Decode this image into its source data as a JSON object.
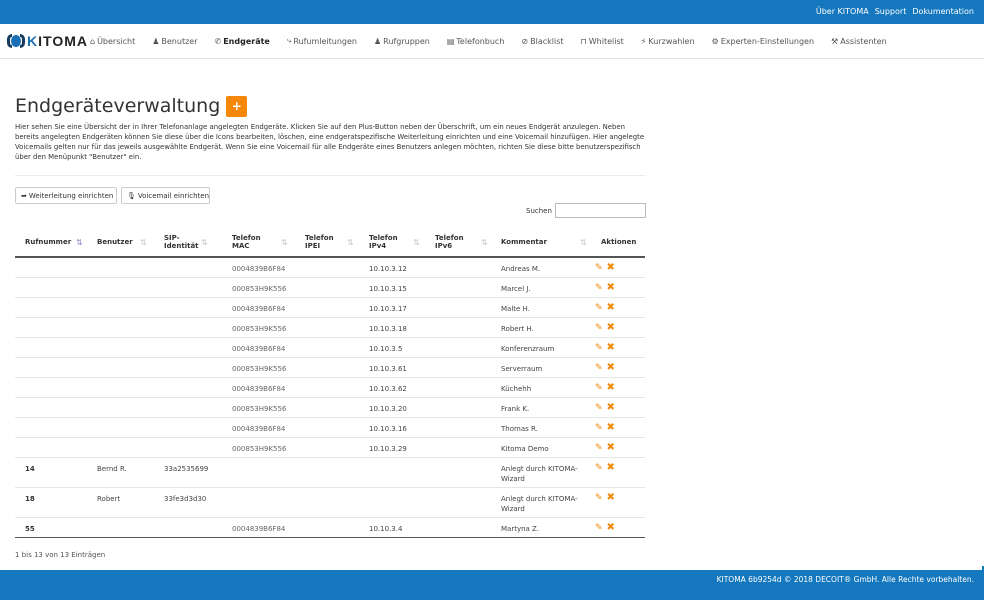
{
  "topbar": {
    "links": [
      "Über KITOMA",
      "Support",
      "Dokumentation"
    ]
  },
  "logo": {
    "text_k": "K",
    "text_rest": "ITOMA"
  },
  "nav": {
    "items": [
      {
        "label": "Übersicht",
        "icon": "home-icon",
        "glyph": "⌂"
      },
      {
        "label": "Benutzer",
        "icon": "user-icon",
        "glyph": "♟"
      },
      {
        "label": "Endgeräte",
        "icon": "phone-icon",
        "glyph": "✆"
      },
      {
        "label": "Rufumleitungen",
        "icon": "forward-icon",
        "glyph": "⤷"
      },
      {
        "label": "Rufgruppen",
        "icon": "users-icon",
        "glyph": "♟"
      },
      {
        "label": "Telefonbuch",
        "icon": "book-icon",
        "glyph": "▤"
      },
      {
        "label": "Blacklist",
        "icon": "ban-icon",
        "glyph": "⊘"
      },
      {
        "label": "Whitelist",
        "icon": "unlock-icon",
        "glyph": "⊓"
      },
      {
        "label": "Kurzwahlen",
        "icon": "bolt-icon",
        "glyph": "⚡"
      },
      {
        "label": "Experten-Einstellungen",
        "icon": "gears-icon",
        "glyph": "⚙"
      },
      {
        "label": "Assistenten",
        "icon": "wand-icon",
        "glyph": "⚒"
      }
    ],
    "active": "Endgeräte"
  },
  "page": {
    "title": "Endgeräteverwaltung",
    "plus_label": "+",
    "description": "Hier sehen Sie eine Übersicht der in Ihrer Telefonanlage angelegten Endgeräte. Klicken Sie auf den Plus-Button neben der Überschrift, um ein neues Endgerät anzulegen. Neben bereits angelegten Endgeräten können Sie diese über die Icons bearbeiten, löschen, eine endgeratspezifische Weiterleitung einrichten und eine Voicemail hinzufügen. Hier angelegte Voicemails gelten nur für das jeweils ausgewählte Endgerät. Wenn Sie eine Voicemail für alle Endgeräte eines Benutzers anlegen möchten, richten Sie diese bitte benutzerspezifisch über den Menüpunkt \"Benutzer\" ein."
  },
  "toolbar": {
    "forward_label": "Weiterleitung einrichten",
    "voicemail_label": "Voicemail einrichten"
  },
  "search": {
    "label": "Suchen",
    "value": "",
    "placeholder": ""
  },
  "table": {
    "headers": [
      {
        "line1": "Rufnummer",
        "line2": ""
      },
      {
        "line1": "Benutzer",
        "line2": ""
      },
      {
        "line1": "SIP-",
        "line2": "Identität"
      },
      {
        "line1": "Telefon",
        "line2": "MAC"
      },
      {
        "line1": "Telefon",
        "line2": "IPEI"
      },
      {
        "line1": "Telefon",
        "line2": "IPv4"
      },
      {
        "line1": "Telefon",
        "line2": "IPv6"
      },
      {
        "line1": "Kommentar",
        "line2": ""
      },
      {
        "line1": "Aktionen",
        "line2": ""
      }
    ],
    "rows": [
      {
        "rufnummer": "",
        "benutzer": "",
        "sip": "",
        "mac": "0004839B6F84",
        "ipei": "",
        "ipv4": "10.10.3.12",
        "ipv6": "",
        "kommentar": "Andreas M.",
        "tall": false
      },
      {
        "rufnummer": "",
        "benutzer": "",
        "sip": "",
        "mac": "000853H9K556",
        "ipei": "",
        "ipv4": "10.10.3.15",
        "ipv6": "",
        "kommentar": "Marcel J.",
        "tall": false
      },
      {
        "rufnummer": "",
        "benutzer": "",
        "sip": "",
        "mac": "0004839B6F84",
        "ipei": "",
        "ipv4": "10.10.3.17",
        "ipv6": "",
        "kommentar": "Malte H.",
        "tall": false
      },
      {
        "rufnummer": "",
        "benutzer": "",
        "sip": "",
        "mac": "000853H9K556",
        "ipei": "",
        "ipv4": "10.10.3.18",
        "ipv6": "",
        "kommentar": "Robert H.",
        "tall": false
      },
      {
        "rufnummer": "",
        "benutzer": "",
        "sip": "",
        "mac": "0004839B6F84",
        "ipei": "",
        "ipv4": "10.10.3.5",
        "ipv6": "",
        "kommentar": "Konferenzraum",
        "tall": false
      },
      {
        "rufnummer": "",
        "benutzer": "",
        "sip": "",
        "mac": "000853H9K556",
        "ipei": "",
        "ipv4": "10.10.3.61",
        "ipv6": "",
        "kommentar": "Serverraum",
        "tall": false
      },
      {
        "rufnummer": "",
        "benutzer": "",
        "sip": "",
        "mac": "0004839B6F84",
        "ipei": "",
        "ipv4": "10.10.3.62",
        "ipv6": "",
        "kommentar": "Küchehh",
        "tall": false
      },
      {
        "rufnummer": "",
        "benutzer": "",
        "sip": "",
        "mac": "000853H9K556",
        "ipei": "",
        "ipv4": "10.10.3.20",
        "ipv6": "",
        "kommentar": "Frank K.",
        "tall": false
      },
      {
        "rufnummer": "",
        "benutzer": "",
        "sip": "",
        "mac": "0004839B6F84",
        "ipei": "",
        "ipv4": "10.10.3.16",
        "ipv6": "",
        "kommentar": "Thomas R.",
        "tall": false
      },
      {
        "rufnummer": "",
        "benutzer": "",
        "sip": "",
        "mac": "000853H9K556",
        "ipei": "",
        "ipv4": "10.10.3.29",
        "ipv6": "",
        "kommentar": "Kitoma Demo",
        "tall": false
      },
      {
        "rufnummer": "14",
        "benutzer": "Bernd R.",
        "sip": "33a2535699",
        "mac": "",
        "ipei": "",
        "ipv4": "",
        "ipv6": "",
        "kommentar": "Anlegt durch KITOMA-Wizard",
        "tall": true
      },
      {
        "rufnummer": "18",
        "benutzer": "Robert",
        "sip": "33fe3d3d30",
        "mac": "",
        "ipei": "",
        "ipv4": "",
        "ipv6": "",
        "kommentar": "Anlegt durch KITOMA-Wizard",
        "tall": true
      },
      {
        "rufnummer": "55",
        "benutzer": "",
        "sip": "",
        "mac": "0004839B6F84",
        "ipei": "",
        "ipv4": "10.10.3.4",
        "ipv6": "",
        "kommentar": "Martyna Z.",
        "tall": false
      }
    ],
    "info": "1 bis 13 von 13 Einträgen"
  },
  "footer": {
    "text": "KITOMA 6b9254d   © 2018 DECOIT® GmbH. Alle Rechte vorbehalten."
  },
  "colors": {
    "brand": "#1577bd",
    "accent": "#f5870a"
  }
}
